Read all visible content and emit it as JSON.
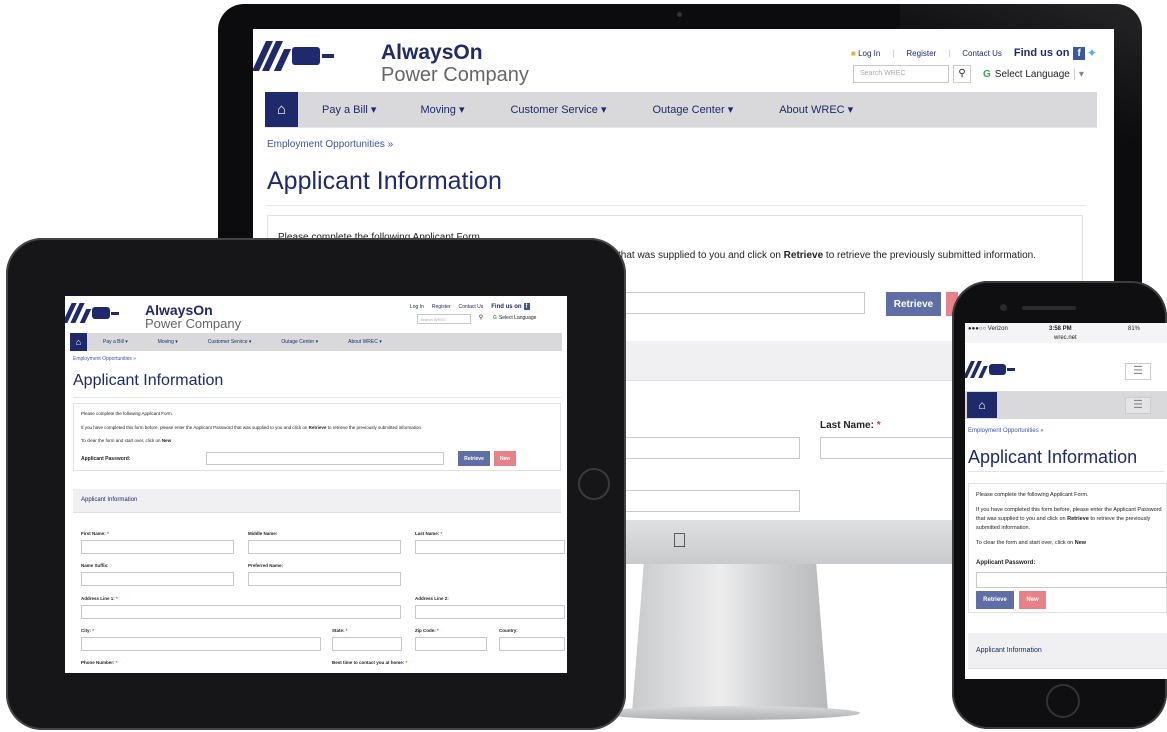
{
  "site": {
    "brand_line1": "AlwaysOn",
    "brand_line2": "Power Company",
    "login": "Log In",
    "register": "Register",
    "contact": "Contact Us",
    "find_us": "Find us on",
    "search_placeholder": "Search WREC",
    "select_language": "Select Language",
    "nav": [
      "Pay a Bill ▾",
      "Moving ▾",
      "Customer Service ▾",
      "Outage Center ▾",
      "About WREC ▾"
    ],
    "breadcrumb": "Employment Opportunities »",
    "page_title": "Applicant Information"
  },
  "form": {
    "intro": "Please complete the following Applicant Form.",
    "intro2_prefix": "If you have completed this form before, please enter the Applicant Password that was supplied to you and click on",
    "retrieve_word": "Retrieve",
    "intro2_suffix": "to retrieve the previously submitted information.",
    "intro2_cut": "that was supplied to you and click on",
    "clear_prefix": "To clear the form and start over, click on",
    "new_word": "New",
    "password_label": "Applicant Password:",
    "retrieve_btn": "Retrieve",
    "new_btn": "New",
    "section_title": "Applicant Information",
    "fields": {
      "first": "First Name:",
      "middle": "Middle Name:",
      "last": "Last Name:",
      "suffix": "Name Suffix:",
      "preferred": "Preferred Name:",
      "addr1": "Address Line 1:",
      "addr2": "Address Line 2:",
      "city": "City:",
      "state": "State:",
      "zip": "Zip Code:",
      "country": "Country:",
      "phone": "Phone Number:",
      "besttime": "Best time to contact you at home:"
    },
    "required_mark": "*"
  },
  "phone": {
    "carrier": "●●●○○ Verizon",
    "time": "3:58 PM",
    "battery": "81%",
    "url": "wrec.net"
  }
}
